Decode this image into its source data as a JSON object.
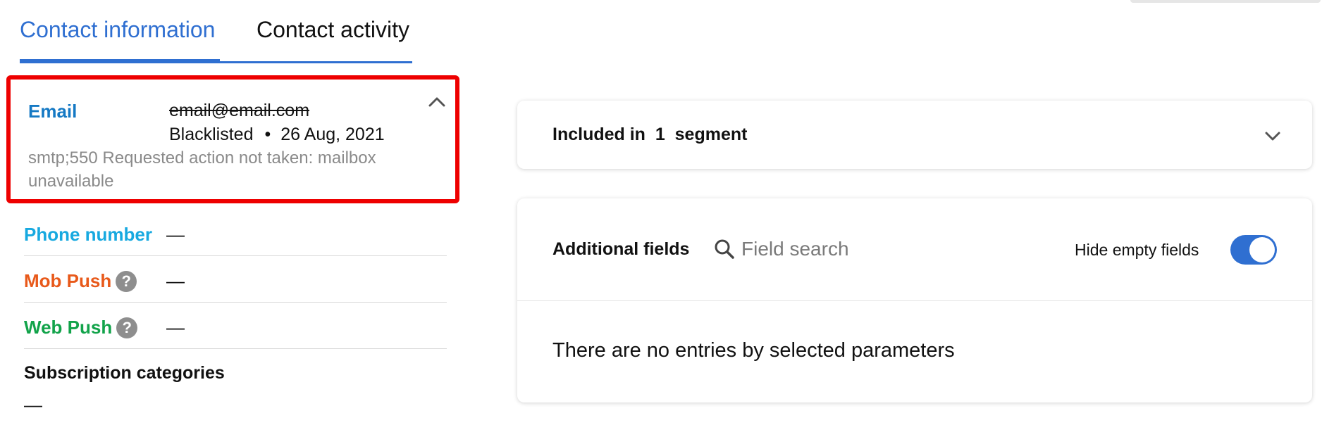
{
  "tabs": {
    "active": "Contact information",
    "inactive": "Contact activity"
  },
  "email": {
    "label": "Email",
    "address": "email@email.com",
    "status": "Blacklisted",
    "separator": "•",
    "date": "26 Aug, 2021",
    "error": "smtp;550 Requested action not taken: mailbox unavailable",
    "collapse_icon": "chevron-up-icon"
  },
  "channels": {
    "phone": {
      "label": "Phone number",
      "value": "—"
    },
    "mob_push": {
      "label": "Mob Push",
      "value": "—",
      "help": "?"
    },
    "web_push": {
      "label": "Web Push",
      "value": "—",
      "help": "?"
    }
  },
  "subscription": {
    "title": "Subscription categories",
    "value": "—"
  },
  "segments": {
    "text": "Included in  1  segment",
    "chevron_icon": "chevron-down-icon"
  },
  "additional_fields": {
    "title": "Additional fields",
    "search_placeholder": "Field search",
    "hide_empty_label": "Hide empty fields",
    "hide_empty_enabled": true,
    "empty_message": "There are no entries by selected parameters"
  },
  "colors": {
    "accent": "#2f6fd1",
    "email_label": "#1579c4",
    "phone_label": "#17a9e0",
    "mob_push_label": "#e8591a",
    "web_push_label": "#12a34a",
    "highlight_border": "#ee0000"
  }
}
